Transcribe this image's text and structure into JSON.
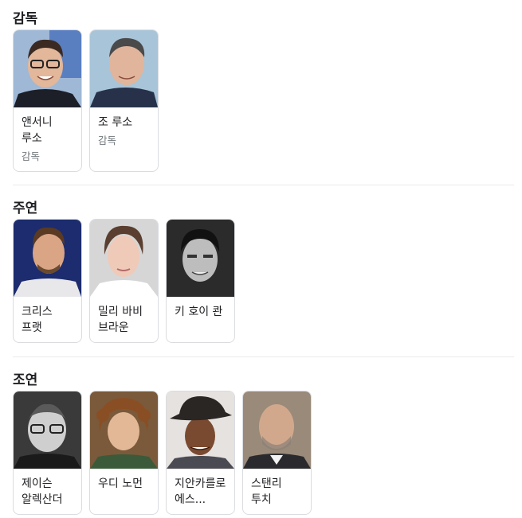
{
  "sections": [
    {
      "title": "감독",
      "people": [
        {
          "name": "앤서니 루소",
          "role": "감독"
        },
        {
          "name": "조 루소",
          "role": "감독"
        }
      ]
    },
    {
      "title": "주연",
      "people": [
        {
          "name": "크리스 프랫"
        },
        {
          "name": "밀리 바비 브라운"
        },
        {
          "name": "키 호이 콴"
        }
      ]
    },
    {
      "title": "조연",
      "people": [
        {
          "name": "제이슨 알렉산더"
        },
        {
          "name": "우디 노먼"
        },
        {
          "name": "지안카를로 에스..."
        },
        {
          "name": "스탠리 투치"
        }
      ]
    }
  ]
}
